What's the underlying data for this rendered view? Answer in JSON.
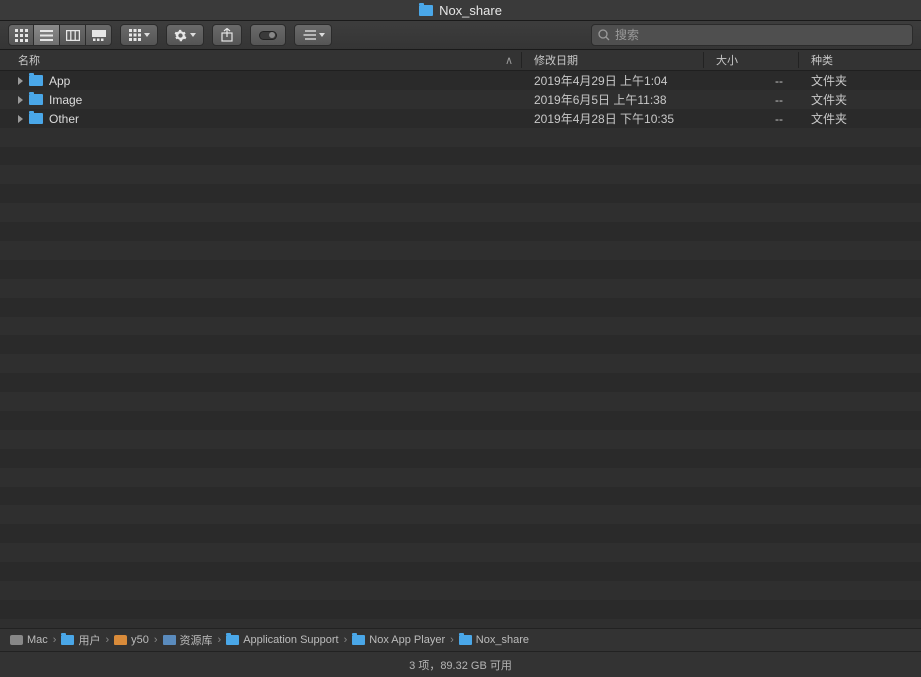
{
  "window": {
    "title": "Nox_share"
  },
  "toolbar": {
    "search_placeholder": "搜索"
  },
  "columns": {
    "name": "名称",
    "date": "修改日期",
    "size": "大小",
    "kind": "种类"
  },
  "files": [
    {
      "name": "App",
      "date": "2019年4月29日 上午1:04",
      "size": "--",
      "kind": "文件夹"
    },
    {
      "name": "Image",
      "date": "2019年6月5日 上午11:38",
      "size": "--",
      "kind": "文件夹"
    },
    {
      "name": "Other",
      "date": "2019年4月28日 下午10:35",
      "size": "--",
      "kind": "文件夹"
    }
  ],
  "path": [
    {
      "label": "Mac",
      "icon": "disk"
    },
    {
      "label": "用户",
      "icon": "folder"
    },
    {
      "label": "y50",
      "icon": "home"
    },
    {
      "label": "资源库",
      "icon": "lib"
    },
    {
      "label": "Application Support",
      "icon": "folder"
    },
    {
      "label": "Nox App Player",
      "icon": "folder"
    },
    {
      "label": "Nox_share",
      "icon": "folder"
    }
  ],
  "status": "3 项，89.32 GB 可用"
}
